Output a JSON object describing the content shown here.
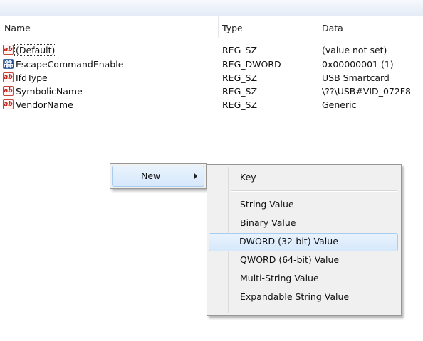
{
  "columns": {
    "name": "Name",
    "type": "Type",
    "data": "Data"
  },
  "rows": [
    {
      "icon": "string-value-icon",
      "glyph": "ab",
      "name": "(Default)",
      "type": "REG_SZ",
      "data": "(value not set)"
    },
    {
      "icon": "binary-value-icon",
      "glyph": "011\n110",
      "name": "EscapeCommandEnable",
      "type": "REG_DWORD",
      "data": "0x00000001 (1)"
    },
    {
      "icon": "string-value-icon",
      "glyph": "ab",
      "name": "IfdType",
      "type": "REG_SZ",
      "data": "USB Smartcard"
    },
    {
      "icon": "string-value-icon",
      "glyph": "ab",
      "name": "SymbolicName",
      "type": "REG_SZ",
      "data": "\\??\\USB#VID_072F8"
    },
    {
      "icon": "string-value-icon",
      "glyph": "ab",
      "name": "VendorName",
      "type": "REG_SZ",
      "data": "Generic"
    }
  ],
  "context_menu": {
    "new_label": "New"
  },
  "submenu": {
    "items": [
      "Key",
      "String Value",
      "Binary Value",
      "DWORD (32-bit) Value",
      "QWORD (64-bit) Value",
      "Multi-String Value",
      "Expandable String Value"
    ],
    "highlighted": "DWORD (32-bit) Value"
  }
}
